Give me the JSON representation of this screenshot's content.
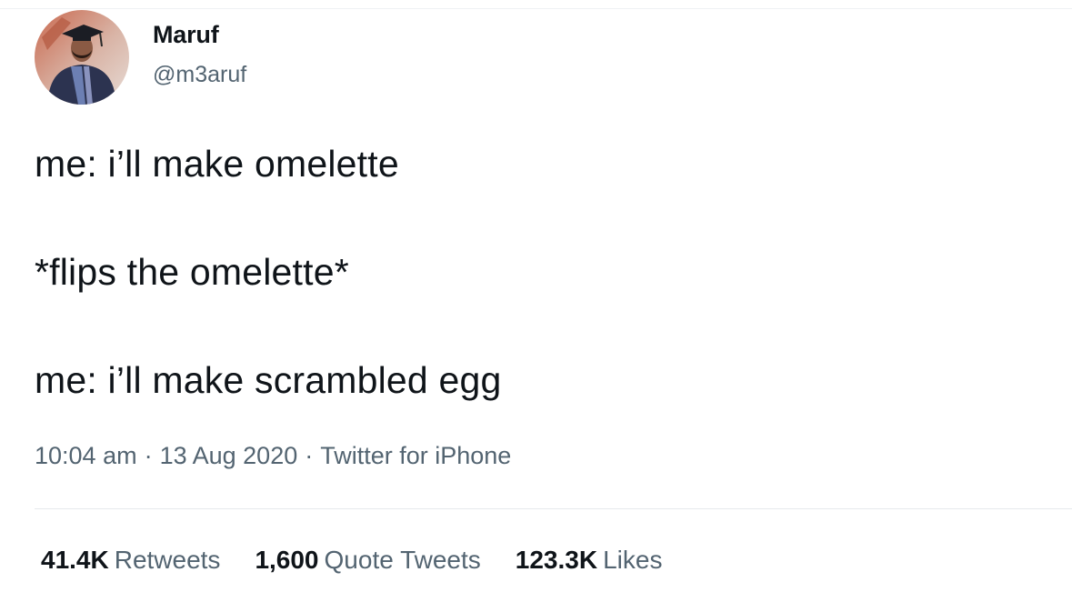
{
  "author": {
    "display_name": "Maruf",
    "handle": "@m3aruf"
  },
  "tweet": {
    "lines": [
      "me: i’ll make omelette",
      "*flips the omelette*",
      "me: i’ll make scrambled egg"
    ]
  },
  "meta": {
    "time": "10:04 am",
    "separator": "·",
    "date": "13 Aug 2020",
    "source": "Twitter for iPhone"
  },
  "stats": {
    "retweets": {
      "count": "41.4K",
      "label": "Retweets"
    },
    "quote_tweets": {
      "count": "1,600",
      "label": "Quote Tweets"
    },
    "likes": {
      "count": "123.3K",
      "label": "Likes"
    }
  },
  "colors": {
    "text_primary": "#0f1419",
    "text_secondary": "#536471",
    "divider": "#e6eaec"
  }
}
